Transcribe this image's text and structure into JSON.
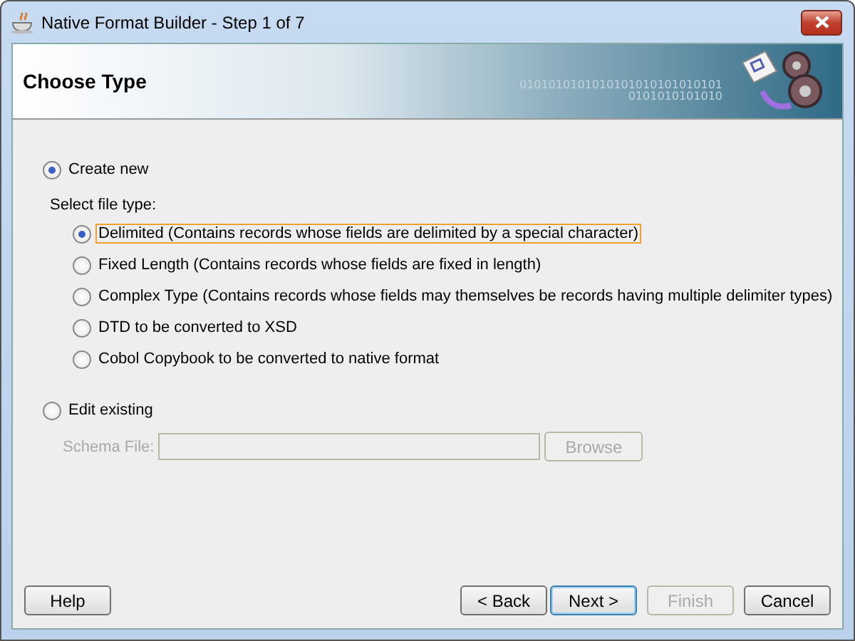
{
  "window": {
    "title": "Native Format Builder - Step 1 of 7"
  },
  "header": {
    "title": "Choose Type",
    "binary_text": "0101010101010101010101010101",
    "binary_text_2": "0101010101010"
  },
  "modes": [
    {
      "label": "Create new",
      "selected": true
    },
    {
      "label": "Edit existing",
      "selected": false
    }
  ],
  "file_type": {
    "label": "Select file type:",
    "options": [
      {
        "label": "Delimited (Contains records whose fields are delimited by a special character)",
        "selected": true,
        "focused": true
      },
      {
        "label": "Fixed Length (Contains records whose fields are fixed in length)",
        "selected": false,
        "focused": false
      },
      {
        "label": "Complex Type (Contains records whose fields may themselves be records having multiple delimiter types)",
        "selected": false,
        "focused": false
      },
      {
        "label": "DTD to be converted to XSD",
        "selected": false,
        "focused": false
      },
      {
        "label": "Cobol Copybook to be converted to native format",
        "selected": false,
        "focused": false
      }
    ]
  },
  "schema_file": {
    "label": "Schema File:",
    "disabled": true,
    "browse": {
      "label": "Browse",
      "disabled": true
    }
  },
  "help_button": {
    "label": "Help",
    "disabled": false,
    "default": false
  },
  "nav_buttons": [
    {
      "label": "< Back",
      "disabled": false,
      "default": false
    },
    {
      "label": "Next >",
      "disabled": false,
      "default": true
    },
    {
      "label": "Finish",
      "disabled": true,
      "default": false
    },
    {
      "label": "Cancel",
      "disabled": false,
      "default": false
    }
  ]
}
